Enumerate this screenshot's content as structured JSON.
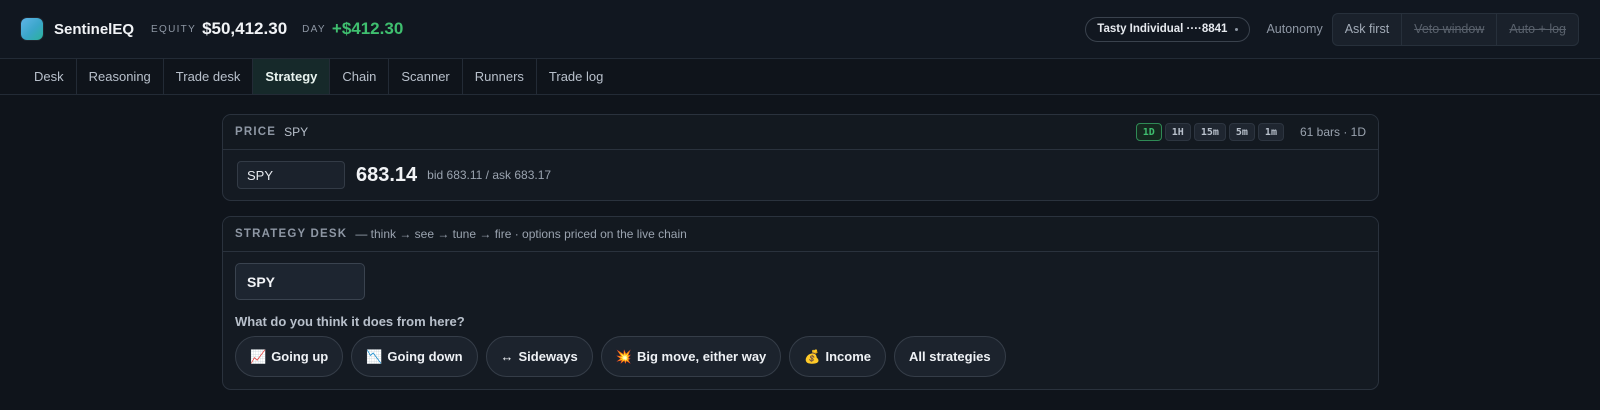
{
  "app": {
    "name": "SentinelEQ",
    "equity_label": "EQUITY",
    "equity_value": "$50,412.30",
    "day_label": "DAY",
    "day_value": "+$412.30"
  },
  "account": {
    "label": "Tasty Individual ····8841"
  },
  "autonomy": {
    "label": "Autonomy",
    "options": [
      "Ask first",
      "Veto window",
      "Auto + log"
    ],
    "selected": "Ask first"
  },
  "tabs": [
    "Desk",
    "Reasoning",
    "Trade desk",
    "Strategy",
    "Chain",
    "Scanner",
    "Runners",
    "Trade log"
  ],
  "active_tab": "Strategy",
  "price_panel": {
    "title": "PRICE",
    "symbol": "SPY",
    "timeframes": [
      "1D",
      "1H",
      "15m",
      "5m",
      "1m"
    ],
    "active_timeframe": "1D",
    "bars_info": "61 bars · 1D",
    "input_value": "SPY",
    "last_price": "683.14",
    "bid_ask": "bid 683.11 / ask 683.17"
  },
  "strategy_panel": {
    "title": "STRATEGY DESK",
    "subtitle": "— think → see → tune → fire · options priced on the live chain",
    "input_value": "SPY",
    "question": "What do you think it does from here?",
    "chips": [
      {
        "emoji": "📈",
        "label": "Going up"
      },
      {
        "emoji": "📉",
        "label": "Going down"
      },
      {
        "emoji": "↔",
        "label": "Sideways"
      },
      {
        "emoji": "💥",
        "label": "Big move, either way"
      },
      {
        "emoji": "💰",
        "label": "Income"
      },
      {
        "emoji": "",
        "label": "All strategies"
      }
    ]
  },
  "colors": {
    "accent_green": "#3fbf6f",
    "active_tab_bg": "#16292a",
    "background": "#0f141b"
  }
}
